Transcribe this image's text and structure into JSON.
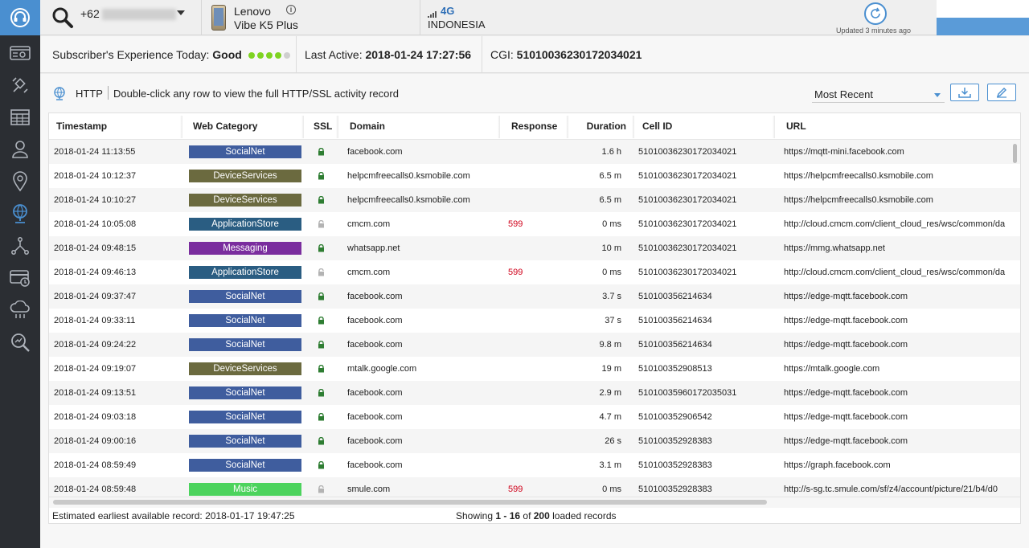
{
  "topbar": {
    "msisdn_prefix": "+62",
    "device_brand": "Lenovo",
    "device_model": "Vibe K5 Plus",
    "network_type": "4G",
    "country": "INDONESIA",
    "updated": "Updated 3 minutes ago"
  },
  "status": {
    "experience_label": "Subscriber's Experience Today:",
    "experience_value": "Good",
    "experience_dots": 4,
    "experience_dots_total": 5,
    "last_active_label": "Last Active:",
    "last_active_value": "2018-01-24 17:27:56",
    "cgi_label": "CGI:",
    "cgi_value": "51010036230172034021"
  },
  "panel": {
    "protocol": "HTTP",
    "hint": "Double-click any row to view the full HTTP/SSL activity record",
    "sort_value": "Most Recent"
  },
  "columns": [
    "Timestamp",
    "Web Category",
    "SSL",
    "Domain",
    "Response",
    "Duration",
    "Cell ID",
    "URL"
  ],
  "category_colors": {
    "SocialNet": "#3f5d9e",
    "DeviceServices": "#6b6a3f",
    "ApplicationStore": "#2a5d82",
    "Messaging": "#7a2d9e",
    "Music": "#4cd35d"
  },
  "rows": [
    {
      "timestamp": "2018-01-24 11:13:55",
      "category": "SocialNet",
      "ssl": true,
      "domain": "facebook.com",
      "response": "",
      "duration": "1.6 h",
      "cell_id": "51010036230172034021",
      "url": "https://mqtt-mini.facebook.com"
    },
    {
      "timestamp": "2018-01-24 10:12:37",
      "category": "DeviceServices",
      "ssl": true,
      "domain": "helpcmfreecalls0.ksmobile.com",
      "response": "",
      "duration": "6.5 m",
      "cell_id": "51010036230172034021",
      "url": "https://helpcmfreecalls0.ksmobile.com"
    },
    {
      "timestamp": "2018-01-24 10:10:27",
      "category": "DeviceServices",
      "ssl": true,
      "domain": "helpcmfreecalls0.ksmobile.com",
      "response": "",
      "duration": "6.5 m",
      "cell_id": "51010036230172034021",
      "url": "https://helpcmfreecalls0.ksmobile.com"
    },
    {
      "timestamp": "2018-01-24 10:05:08",
      "category": "ApplicationStore",
      "ssl": false,
      "domain": "cmcm.com",
      "response": "599",
      "duration": "0 ms",
      "cell_id": "51010036230172034021",
      "url": "http://cloud.cmcm.com/client_cloud_res/wsc/common/da"
    },
    {
      "timestamp": "2018-01-24 09:48:15",
      "category": "Messaging",
      "ssl": true,
      "domain": "whatsapp.net",
      "response": "",
      "duration": "10 m",
      "cell_id": "51010036230172034021",
      "url": "https://mmg.whatsapp.net"
    },
    {
      "timestamp": "2018-01-24 09:46:13",
      "category": "ApplicationStore",
      "ssl": false,
      "domain": "cmcm.com",
      "response": "599",
      "duration": "0 ms",
      "cell_id": "51010036230172034021",
      "url": "http://cloud.cmcm.com/client_cloud_res/wsc/common/da"
    },
    {
      "timestamp": "2018-01-24 09:37:47",
      "category": "SocialNet",
      "ssl": true,
      "domain": "facebook.com",
      "response": "",
      "duration": "3.7 s",
      "cell_id": "510100356214634",
      "url": "https://edge-mqtt.facebook.com"
    },
    {
      "timestamp": "2018-01-24 09:33:11",
      "category": "SocialNet",
      "ssl": true,
      "domain": "facebook.com",
      "response": "",
      "duration": "37 s",
      "cell_id": "510100356214634",
      "url": "https://edge-mqtt.facebook.com"
    },
    {
      "timestamp": "2018-01-24 09:24:22",
      "category": "SocialNet",
      "ssl": true,
      "domain": "facebook.com",
      "response": "",
      "duration": "9.8 m",
      "cell_id": "510100356214634",
      "url": "https://edge-mqtt.facebook.com"
    },
    {
      "timestamp": "2018-01-24 09:19:07",
      "category": "DeviceServices",
      "ssl": true,
      "domain": "mtalk.google.com",
      "response": "",
      "duration": "19 m",
      "cell_id": "510100352908513",
      "url": "https://mtalk.google.com"
    },
    {
      "timestamp": "2018-01-24 09:13:51",
      "category": "SocialNet",
      "ssl": true,
      "domain": "facebook.com",
      "response": "",
      "duration": "2.9 m",
      "cell_id": "51010035960172035031",
      "url": "https://edge-mqtt.facebook.com"
    },
    {
      "timestamp": "2018-01-24 09:03:18",
      "category": "SocialNet",
      "ssl": true,
      "domain": "facebook.com",
      "response": "",
      "duration": "4.7 m",
      "cell_id": "510100352906542",
      "url": "https://edge-mqtt.facebook.com"
    },
    {
      "timestamp": "2018-01-24 09:00:16",
      "category": "SocialNet",
      "ssl": true,
      "domain": "facebook.com",
      "response": "",
      "duration": "26 s",
      "cell_id": "510100352928383",
      "url": "https://edge-mqtt.facebook.com"
    },
    {
      "timestamp": "2018-01-24 08:59:49",
      "category": "SocialNet",
      "ssl": true,
      "domain": "facebook.com",
      "response": "",
      "duration": "3.1 m",
      "cell_id": "510100352928383",
      "url": "https://graph.facebook.com"
    },
    {
      "timestamp": "2018-01-24 08:59:48",
      "category": "Music",
      "ssl": false,
      "domain": "smule.com",
      "response": "599",
      "duration": "0 ms",
      "cell_id": "510100352928383",
      "url": "http://s-sg.tc.smule.com/sf/z4/account/picture/21/b4/d0"
    }
  ],
  "footer": {
    "earliest": "Estimated earliest available record: 2018-01-17 19:47:25",
    "showing_prefix": "Showing ",
    "showing_range": "1 - 16",
    "showing_mid": " of ",
    "showing_total": "200",
    "showing_suffix": " loaded records"
  }
}
